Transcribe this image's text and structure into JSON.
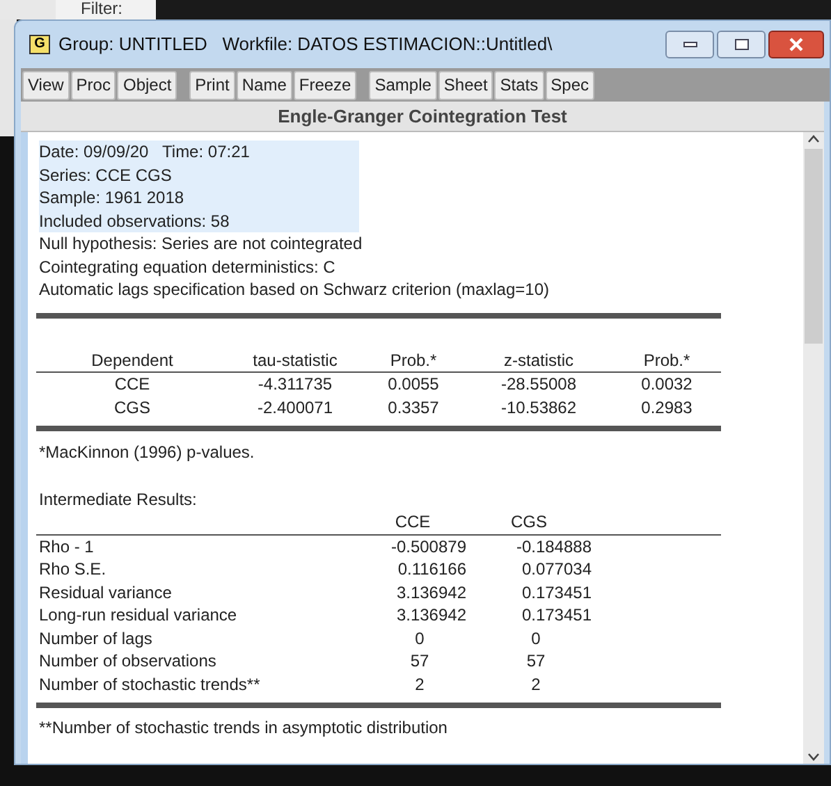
{
  "background_tab": {
    "label": "Filter:"
  },
  "window": {
    "icon": "G",
    "title": "Group: UNTITLED   Workfile: DATOS ESTIMACION::Untitled\\"
  },
  "toolbar_groups": [
    [
      "View",
      "Proc",
      "Object"
    ],
    [
      "Print",
      "Name",
      "Freeze"
    ],
    [
      "Sample",
      "Sheet",
      "Stats",
      "Spec"
    ]
  ],
  "view_title": "Engle-Granger Cointegration Test",
  "header_lines": [
    {
      "text": "Date: 09/09/20   Time: 07:21",
      "selected": true
    },
    {
      "text": "Series: CCE CGS",
      "selected": true
    },
    {
      "text": "Sample: 1961 2018",
      "selected": true
    },
    {
      "text": "Included observations: 58",
      "selected": true
    },
    {
      "text": "Null hypothesis: Series are not cointegrated",
      "selected": false
    },
    {
      "text": "Cointegrating equation deterministics: C",
      "selected": false
    },
    {
      "text": "Automatic lags specification based on Schwarz criterion (maxlag=10)",
      "selected": false
    }
  ],
  "test_table": {
    "columns": [
      "Dependent",
      "tau-statistic",
      "Prob.*",
      "z-statistic",
      "Prob.*"
    ],
    "rows": [
      [
        "CCE",
        "-4.311735",
        "0.0055",
        "-28.55008",
        "0.0032"
      ],
      [
        "CGS",
        "-2.400071",
        "0.3357",
        "-10.53862",
        "0.2983"
      ]
    ]
  },
  "footnote": "*MacKinnon (1996) p-values.",
  "intermediate_title": "Intermediate Results:",
  "intermediate_table": {
    "columns": [
      "",
      "CCE",
      "CGS"
    ],
    "rows": [
      [
        "Rho - 1",
        "-0.500879",
        "-0.184888"
      ],
      [
        "Rho S.E.",
        "0.116166",
        "0.077034"
      ],
      [
        "Residual variance",
        "3.136942",
        "0.173451"
      ],
      [
        "Long-run residual variance",
        "3.136942",
        "0.173451"
      ],
      [
        "Number of lags",
        "0",
        "0"
      ],
      [
        "Number of observations",
        "57",
        "57"
      ],
      [
        "Number of stochastic trends**",
        "2",
        "2"
      ]
    ]
  },
  "footnote_2": "**Number of stochastic trends in asymptotic distribution"
}
